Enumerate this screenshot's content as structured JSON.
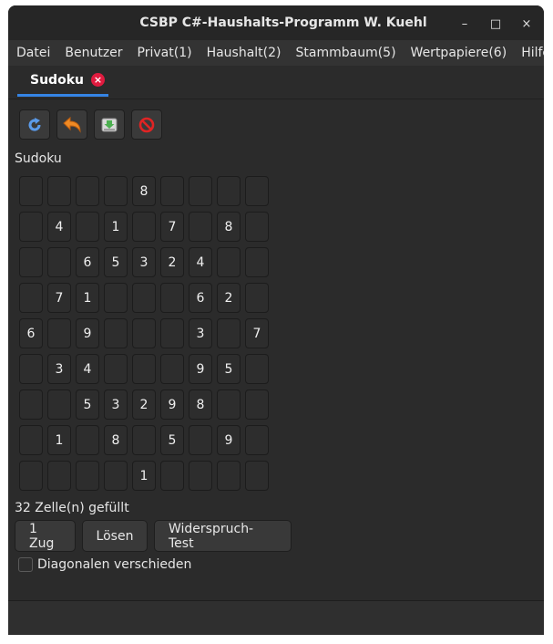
{
  "window": {
    "title": "CSBP C#-Haushalts-Programm W. Kuehl",
    "minimize": "–",
    "maximize": "□",
    "close": "×"
  },
  "menu": [
    "Datei",
    "Benutzer",
    "Privat(1)",
    "Haushalt(2)",
    "Stammbaum(5)",
    "Wertpapiere(6)",
    "Hilfe"
  ],
  "tab": {
    "label": "Sudoku",
    "close": "×"
  },
  "toolbar": {
    "icons": [
      "refresh-icon",
      "undo-icon",
      "save-icon",
      "cancel-icon"
    ]
  },
  "section_label": "Sudoku",
  "grid": [
    [
      "",
      "",
      "",
      "",
      "8",
      "",
      "",
      "",
      ""
    ],
    [
      "",
      "4",
      "",
      "1",
      "",
      "7",
      "",
      "8",
      ""
    ],
    [
      "",
      "",
      "6",
      "5",
      "3",
      "2",
      "4",
      "",
      ""
    ],
    [
      "",
      "7",
      "1",
      "",
      "",
      "",
      "6",
      "2",
      ""
    ],
    [
      "6",
      "",
      "9",
      "",
      "",
      "",
      "3",
      "",
      "7"
    ],
    [
      "",
      "3",
      "4",
      "",
      "",
      "",
      "9",
      "5",
      ""
    ],
    [
      "",
      "",
      "5",
      "3",
      "2",
      "9",
      "8",
      "",
      ""
    ],
    [
      "",
      "1",
      "",
      "8",
      "",
      "5",
      "",
      "9",
      ""
    ],
    [
      "",
      "",
      "",
      "",
      "1",
      "",
      "",
      "",
      ""
    ]
  ],
  "status": "32 Zelle(n) gefüllt",
  "buttons": {
    "one_move": "1 Zug",
    "solve": "Lösen",
    "contradiction_test": "Widerspruch-Test"
  },
  "diagonal": {
    "label": "Diagonalen verschieden",
    "checked": false
  },
  "colors": {
    "accent": "#3584e4",
    "close_red": "#e01b3f"
  }
}
